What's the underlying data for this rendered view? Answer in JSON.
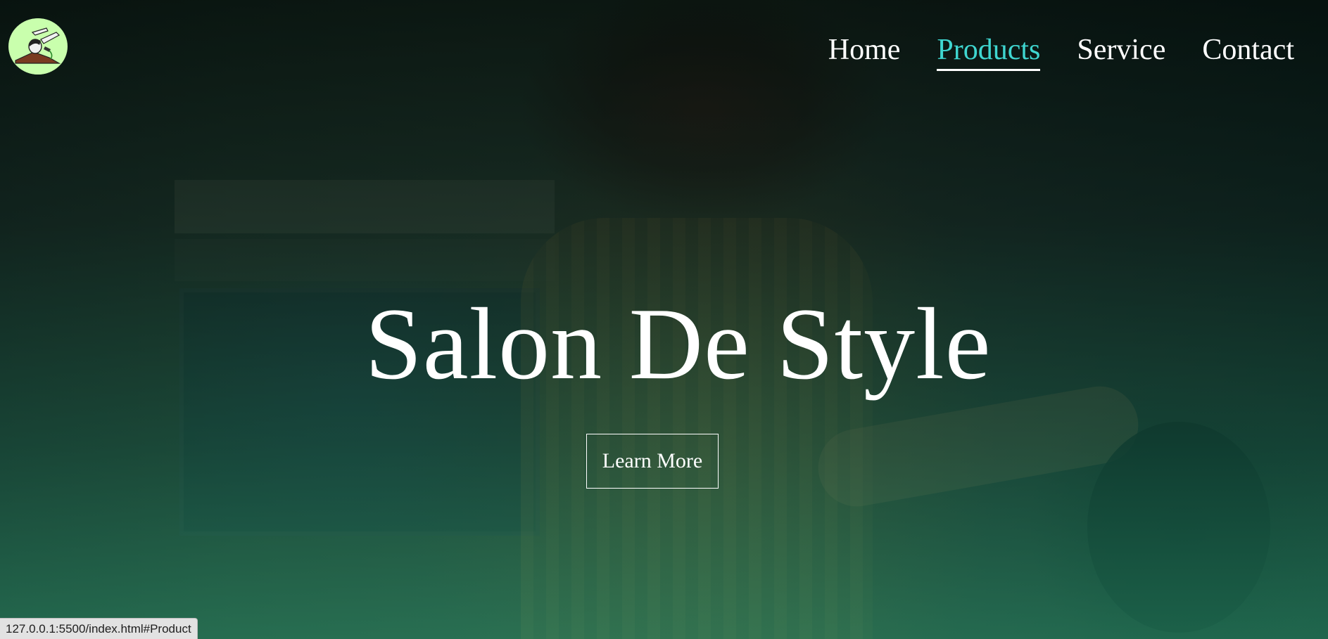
{
  "logo": {
    "icon": "barber-haircut-icon",
    "background": "#c9ffad"
  },
  "nav": {
    "items": [
      {
        "label": "Home",
        "active": false
      },
      {
        "label": "Products",
        "active": true
      },
      {
        "label": "Service",
        "active": false
      },
      {
        "label": "Contact",
        "active": false
      }
    ],
    "active_color": "#3fd6d0"
  },
  "hero": {
    "title": "Salon De Style",
    "cta_label": "Learn More"
  },
  "status_bar": {
    "url": "127.0.0.1:5500/index.html#Product"
  }
}
